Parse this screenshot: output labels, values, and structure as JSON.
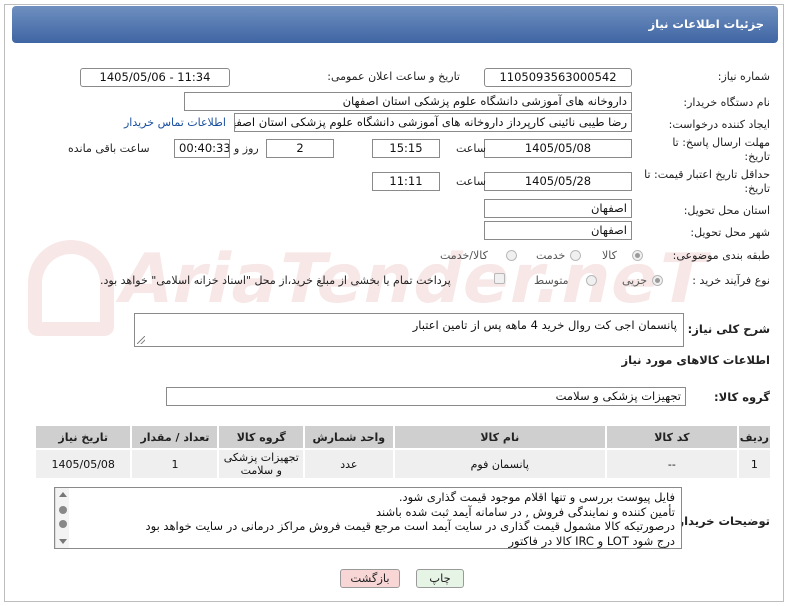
{
  "header": {
    "title": "جزئیات اطلاعات نیاز"
  },
  "need_number": {
    "label": "شماره نیاز:",
    "value": "1105093563000542"
  },
  "announce_datetime": {
    "label": "تاریخ و ساعت اعلان عمومی:",
    "value": "1405/05/06 - 11:34"
  },
  "buyer_org": {
    "label": "نام دستگاه خریدار:",
    "value": "داروخانه های آموزشی دانشگاه علوم پزشکی استان اصفهان"
  },
  "requester": {
    "label": "ایجاد کننده درخواست:",
    "value": "رضا طیبی نائینی کارپرداز داروخانه های آموزشی دانشگاه علوم پزشکی استان اصفهان",
    "contact_link": "اطلاعات تماس خریدار"
  },
  "reply_deadline": {
    "label": "مهلت ارسال پاسخ: تا تاریخ:",
    "date": "1405/05/08",
    "time_label": "ساعت",
    "time": "15:15",
    "days": "2",
    "days_label": "روز و",
    "remaining": "00:40:33",
    "remaining_label": "ساعت باقی مانده"
  },
  "price_validity": {
    "label": "حداقل تاریخ اعتبار قیمت: تا تاریخ:",
    "date": "1405/05/28",
    "time_label": "ساعت",
    "time": "11:11"
  },
  "delivery_province": {
    "label": "استان محل تحویل:",
    "value": "اصفهان"
  },
  "delivery_city": {
    "label": "شهر محل تحویل:",
    "value": "اصفهان"
  },
  "category": {
    "label": "طبقه بندی موضوعی:",
    "options": [
      "کالا",
      "خدمت",
      "کالا/خدمت"
    ],
    "selected": "کالا"
  },
  "purchase_process": {
    "label": "نوع فرآیند خرید :",
    "options": [
      "جزیی",
      "متوسط"
    ],
    "selected": "جزیی",
    "note": "پرداخت تمام یا بخشی از مبلغ خرید،از محل \"اسناد خزانه اسلامی\" خواهد بود."
  },
  "general_description": {
    "label": "شرح کلی نیاز:",
    "value": "پانسمان اجی کت  روال خرید 4 ماهه پس از تامین اعتبار"
  },
  "goods_info": {
    "title": "اطلاعات کالاهای مورد نیاز"
  },
  "goods_group": {
    "label": "گروه کالا:",
    "value": "تجهیزات پزشکی و سلامت"
  },
  "table": {
    "headers": [
      "ردیف",
      "کد کالا",
      "نام کالا",
      "واحد شمارش",
      "گروه کالا",
      "تعداد / مقدار",
      "تاریخ نیاز"
    ],
    "rows": [
      [
        "1",
        "--",
        "پانسمان فوم",
        "عدد",
        "تجهیزات پزشکی و سلامت",
        "1",
        "1405/05/08"
      ]
    ]
  },
  "buyer_notes": {
    "label": "توضیحات خریدار:",
    "lines": [
      "فایل پیوست بررسی و تنها اقلام موجود قیمت گذاری شود.",
      "تأمین کننده و نمایندگی فروش  , در سامانه آیمد ثبت شده باشند",
      "درصورتیکه کالا مشمول قیمت گذاری در سایت آیمد است مرجع قیمت فروش مراکز درمانی در سایت خواهد بود",
      "درج شود LOT و IRC کالا در فاکتور"
    ]
  },
  "buttons": {
    "print": "چاپ",
    "back": "بازگشت"
  },
  "colors": {
    "header": "#4a6fa9",
    "link": "#1a4fa0",
    "back_button": "#f9d6d6",
    "print_button": "#e6f4e6"
  }
}
